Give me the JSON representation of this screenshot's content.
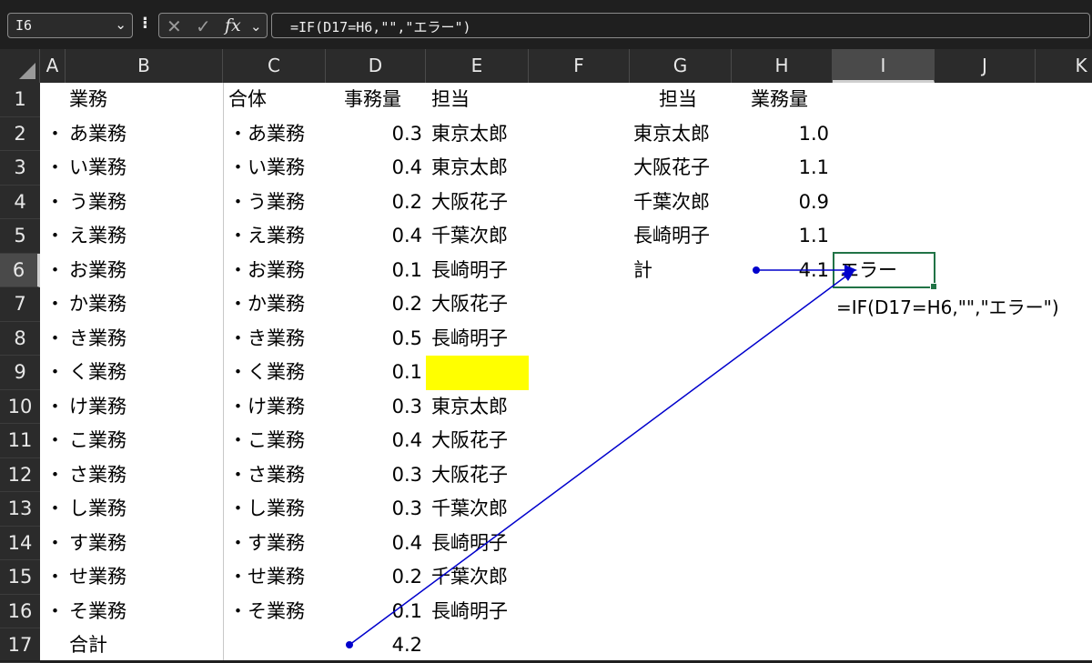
{
  "formula_bar": {
    "name_box": "I6",
    "formula": "=IF(D17=H6,\"\",\"エラー\")",
    "fx_label": "fx"
  },
  "columns": [
    "A",
    "B",
    "C",
    "D",
    "E",
    "F",
    "G",
    "H",
    "I",
    "J",
    "K"
  ],
  "selected_column": "I",
  "rows": [
    "1",
    "2",
    "3",
    "4",
    "5",
    "6",
    "7",
    "8",
    "9",
    "10",
    "11",
    "12",
    "13",
    "14",
    "15",
    "16",
    "17"
  ],
  "selected_row": "6",
  "table_left": {
    "header_b": "業務",
    "bullets": [
      "・",
      "・",
      "・",
      "・",
      "・",
      "・",
      "・",
      "・",
      "・",
      "・",
      "・",
      "・",
      "・",
      "・",
      "・"
    ],
    "items": [
      "あ業務",
      "い業務",
      "う業務",
      "え業務",
      "お業務",
      "か業務",
      "き業務",
      "く業務",
      "け業務",
      "こ業務",
      "さ業務",
      "し業務",
      "す業務",
      "せ業務",
      "そ業務"
    ],
    "total_label": "合計"
  },
  "table_main": {
    "header_c": "合体",
    "header_d": "事務量",
    "header_e": "担当",
    "combined": [
      "・あ業務",
      "・い業務",
      "・う業務",
      "・え業務",
      "・お業務",
      "・か業務",
      "・き業務",
      "・く業務",
      "・け業務",
      "・こ業務",
      "・さ業務",
      "・し業務",
      "・す業務",
      "・せ業務",
      "・そ業務"
    ],
    "volume": [
      "0.3",
      "0.4",
      "0.2",
      "0.4",
      "0.1",
      "0.2",
      "0.5",
      "0.1",
      "0.3",
      "0.4",
      "0.3",
      "0.3",
      "0.4",
      "0.2",
      "0.1"
    ],
    "owner": [
      "東京太郎",
      "東京太郎",
      "大阪花子",
      "千葉次郎",
      "長崎明子",
      "大阪花子",
      "長崎明子",
      "",
      "東京太郎",
      "大阪花子",
      "大阪花子",
      "千葉次郎",
      "長崎明子",
      "千葉次郎",
      "長崎明子"
    ],
    "total_volume": "4.2"
  },
  "table_summary": {
    "header_g": "担当",
    "header_h": "業務量",
    "names": [
      "東京太郎",
      "大阪花子",
      "千葉次郎",
      "長崎明子"
    ],
    "amounts": [
      "1.0",
      "1.1",
      "0.9",
      "1.1"
    ],
    "total_label": "計",
    "total_amount": "4.1",
    "result": "エラー",
    "formula_note": "=IF(D17=H6,\"\",\"エラー\")"
  },
  "colors": {
    "highlight": "#ffff00",
    "selection": "#217346",
    "arrow": "#0000cc"
  }
}
